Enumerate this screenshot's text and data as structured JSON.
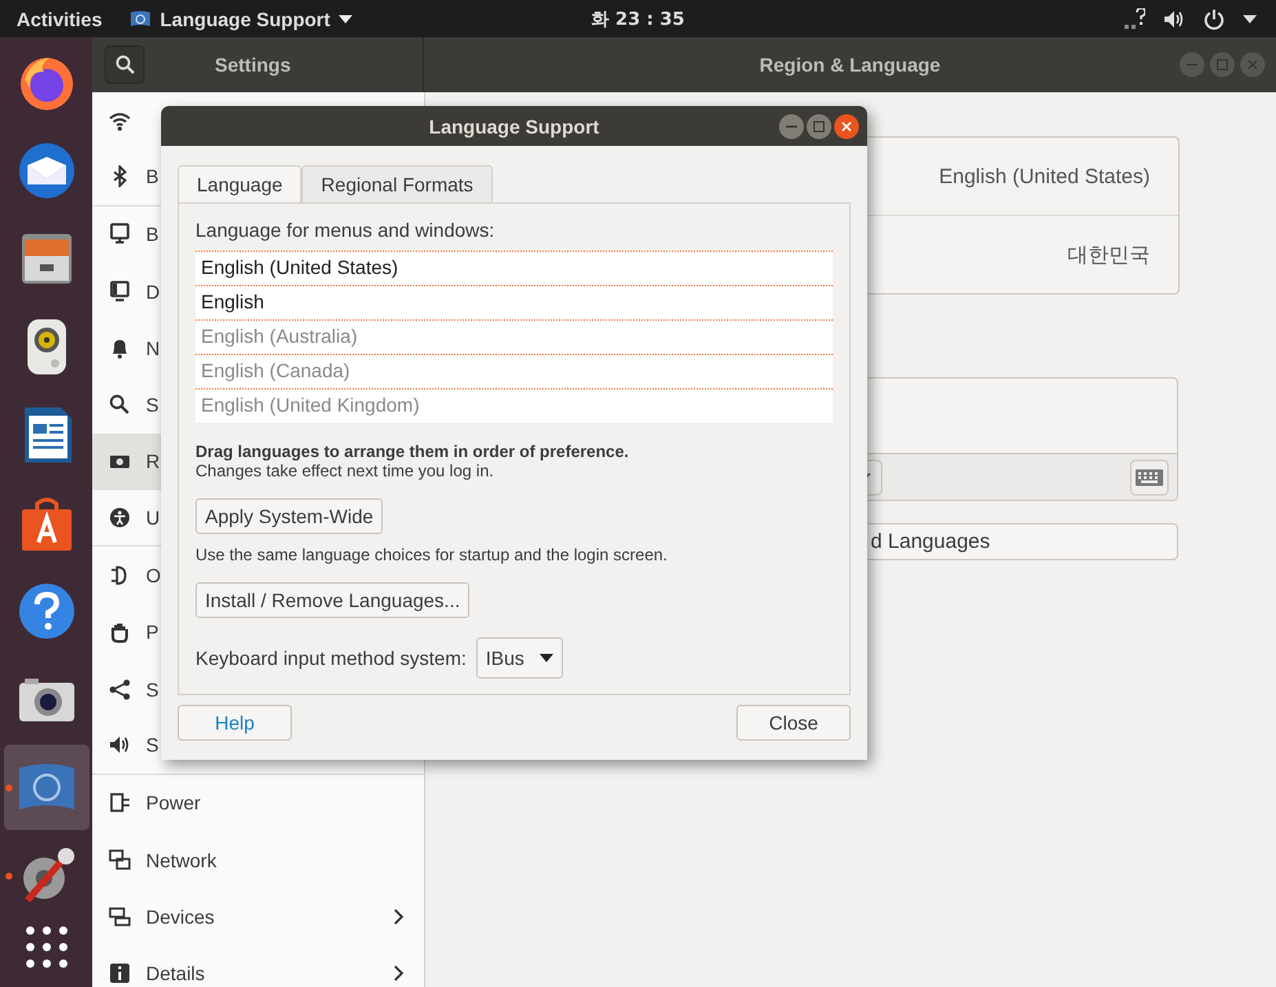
{
  "top_bar": {
    "activities": "Activities",
    "app_menu": "Language Support",
    "clock": "화 23 : 35"
  },
  "dock": [
    {
      "kind": "firefox",
      "running": false,
      "active": false
    },
    {
      "kind": "mail",
      "running": false,
      "active": false
    },
    {
      "kind": "files",
      "running": false,
      "active": false
    },
    {
      "kind": "speaker",
      "running": false,
      "active": false
    },
    {
      "kind": "document",
      "running": false,
      "active": false
    },
    {
      "kind": "store",
      "running": false,
      "active": false
    },
    {
      "kind": "help",
      "running": false,
      "active": false
    },
    {
      "kind": "camera",
      "running": false,
      "active": false
    },
    {
      "kind": "flag",
      "running": true,
      "active": true
    },
    {
      "kind": "tools",
      "running": true,
      "active": false
    }
  ],
  "settings": {
    "title": "Settings",
    "panel_title": "Region & Language",
    "sidebar": [
      {
        "kind": "wifi",
        "selected": false,
        "submenu": false
      },
      {
        "kind": "bluetooth",
        "label": "B",
        "selected": false,
        "submenu": false
      },
      {
        "kind": "monitor",
        "label": "B",
        "selected": false,
        "submenu": false
      },
      {
        "kind": "dock",
        "label": "D",
        "selected": false,
        "submenu": false
      },
      {
        "kind": "bell",
        "label": "N",
        "selected": false,
        "submenu": false
      },
      {
        "kind": "search",
        "label": "S",
        "selected": false,
        "submenu": false
      },
      {
        "kind": "camera",
        "label": "R",
        "selected": true,
        "submenu": false
      },
      {
        "kind": "person",
        "label": "U",
        "selected": false,
        "submenu": false
      },
      {
        "kind": "plug",
        "label": "O",
        "selected": false,
        "submenu": false
      },
      {
        "kind": "hand",
        "label": "P",
        "selected": false,
        "submenu": false
      },
      {
        "kind": "share",
        "label": "S",
        "selected": false,
        "submenu": false
      },
      {
        "kind": "sound",
        "label": "S",
        "selected": false,
        "submenu": false
      },
      {
        "kind": "power",
        "label": "Power",
        "selected": false,
        "submenu": false
      },
      {
        "kind": "network",
        "label": "Network",
        "selected": false,
        "submenu": false
      },
      {
        "kind": "devices",
        "label": "Devices",
        "selected": false,
        "submenu": true
      },
      {
        "kind": "info",
        "label": "Details",
        "selected": false,
        "submenu": true
      }
    ],
    "language_value": "English (United States)",
    "formats_value": "대한민국",
    "manage_button": "d Languages"
  },
  "dialog": {
    "title": "Language Support",
    "tabs": [
      {
        "label": "Language",
        "selected": true
      },
      {
        "label": "Regional Formats",
        "selected": false
      }
    ],
    "list_label": "Language for menus and windows:",
    "languages": [
      {
        "name": "English (United States)",
        "disabled": false
      },
      {
        "name": "English",
        "disabled": false
      },
      {
        "name": "English (Australia)",
        "disabled": true
      },
      {
        "name": "English (Canada)",
        "disabled": true
      },
      {
        "name": "English (United Kingdom)",
        "disabled": true
      }
    ],
    "drag_note": "Drag languages to arrange them in order of preference.",
    "login_note": "Changes take effect next time you log in.",
    "apply_button": "Apply System-Wide",
    "apply_note": "Use the same language choices for startup and the login screen.",
    "install_button": "Install / Remove Languages...",
    "input_label": "Keyboard input method system:",
    "input_value": "IBus",
    "help_button": "Help",
    "close_button": "Close"
  }
}
